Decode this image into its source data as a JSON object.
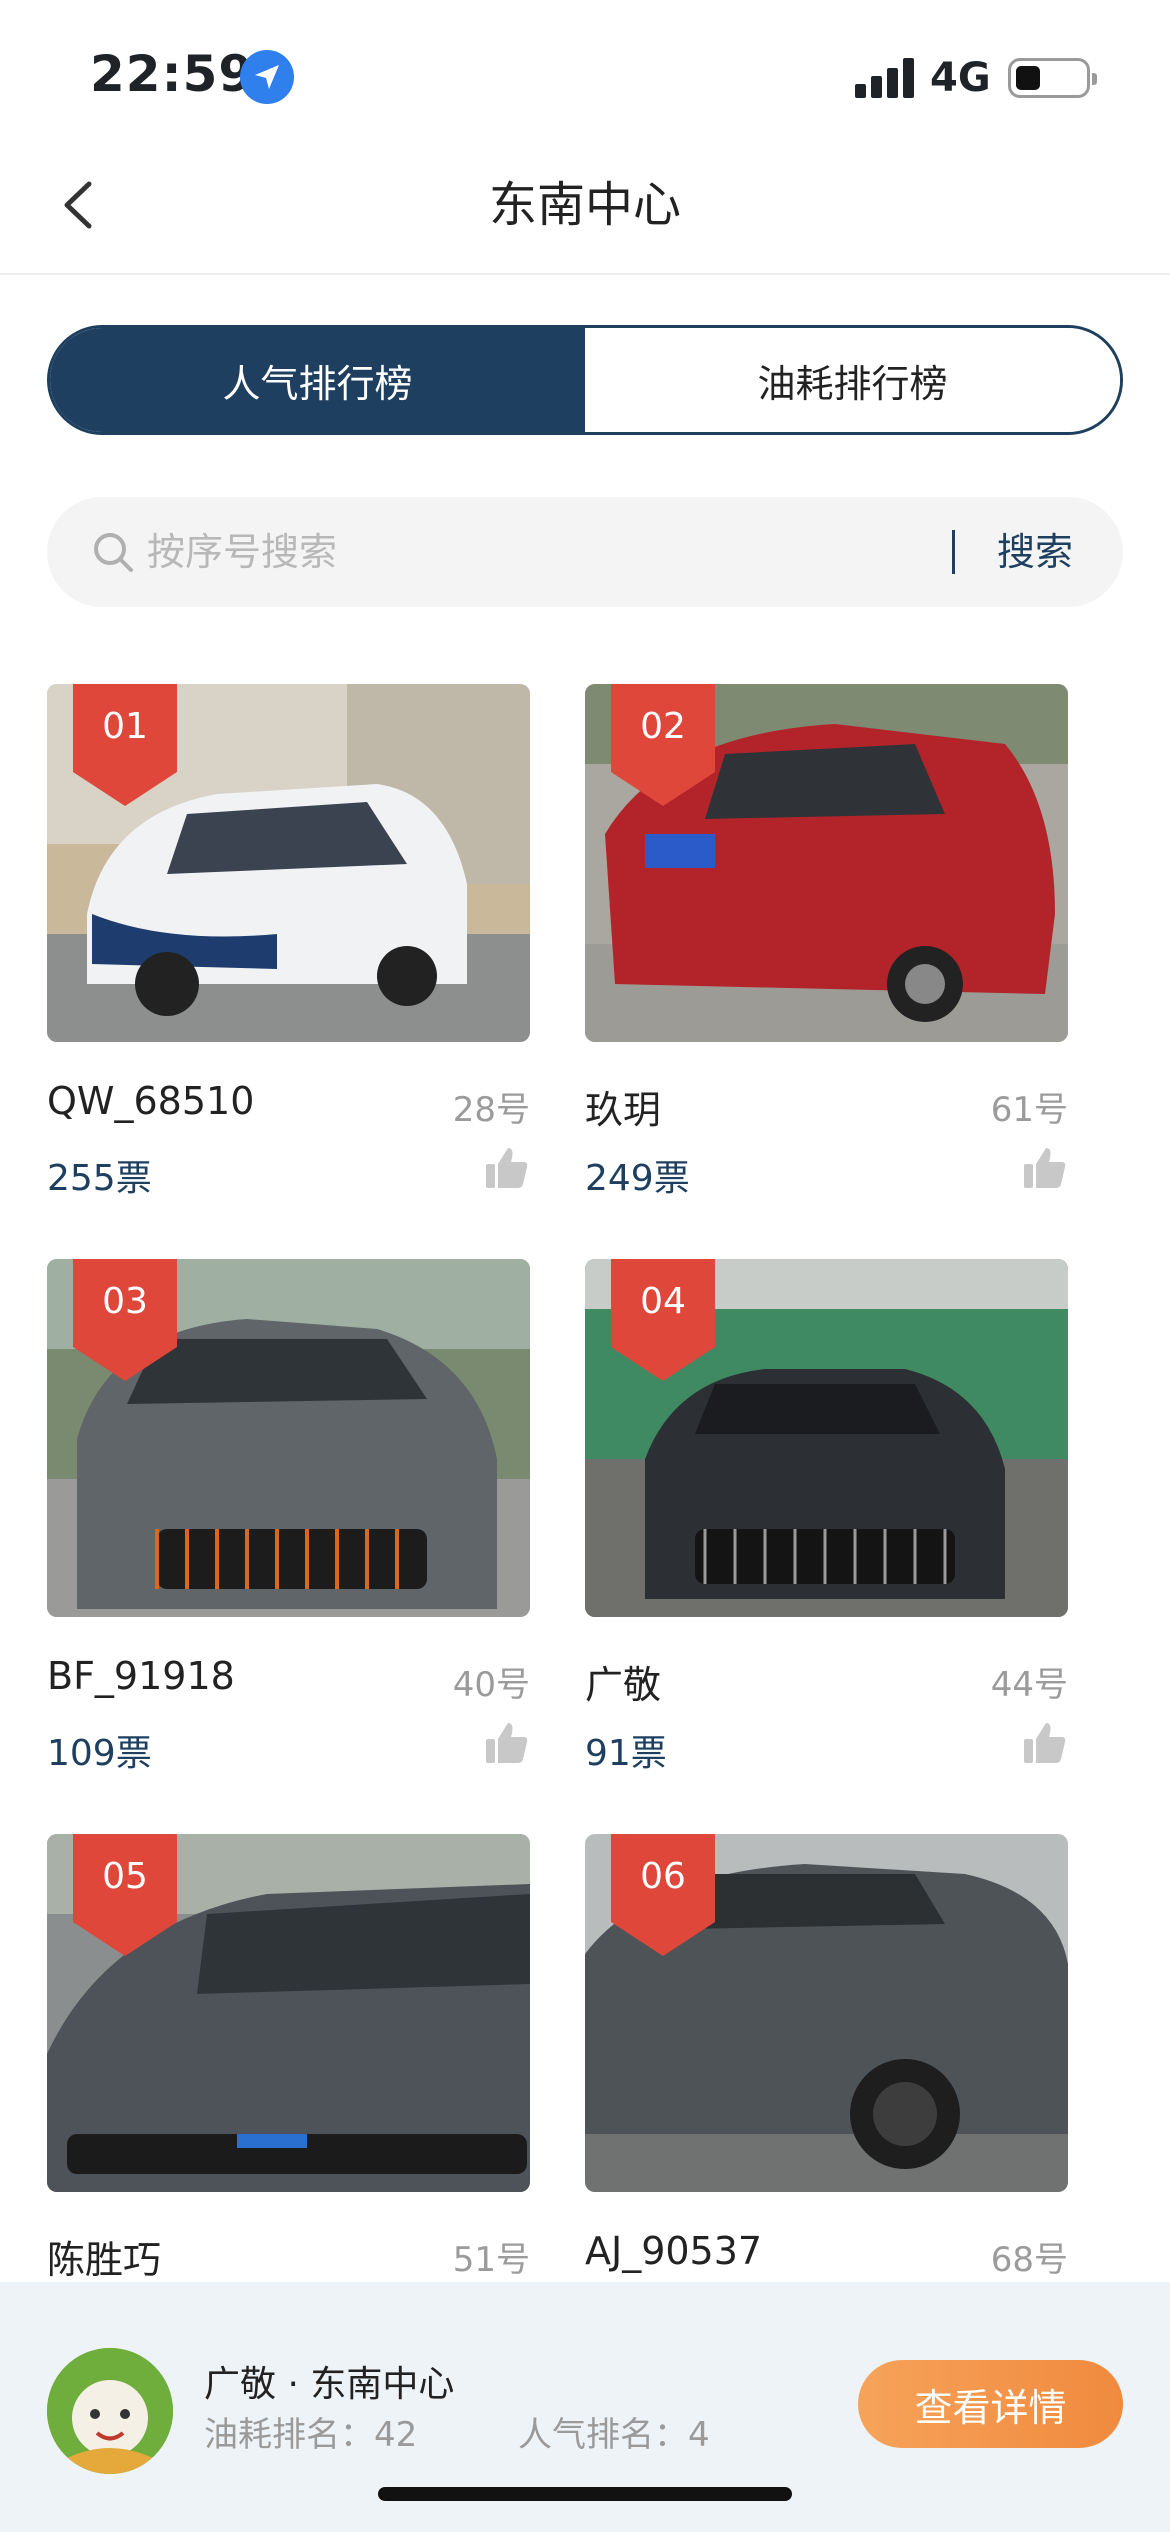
{
  "status_bar": {
    "time": "22:59",
    "network": "4G"
  },
  "nav": {
    "title": "东南中心"
  },
  "tabs": [
    {
      "label": "人气排行榜",
      "active": true
    },
    {
      "label": "油耗排行榜",
      "active": false
    }
  ],
  "search": {
    "placeholder": "按序号搜索",
    "button_label": "搜索"
  },
  "cards": [
    {
      "rank": "01",
      "name": "QW_68510",
      "number": "28号",
      "votes": "255票",
      "car_color": "white"
    },
    {
      "rank": "02",
      "name": "玖玥",
      "number": "61号",
      "votes": "249票",
      "car_color": "red"
    },
    {
      "rank": "03",
      "name": "BF_91918",
      "number": "40号",
      "votes": "109票",
      "car_color": "gray"
    },
    {
      "rank": "04",
      "name": "广敬",
      "number": "44号",
      "votes": "91票",
      "car_color": "dark-gray"
    },
    {
      "rank": "05",
      "name": "陈胜巧",
      "number": "51号",
      "votes": "",
      "car_color": "gray"
    },
    {
      "rank": "06",
      "name": "AJ_90537",
      "number": "68号",
      "votes": "",
      "car_color": "dark-gray"
    }
  ],
  "bottom_bar": {
    "title": "广敬 · 东南中心",
    "fuel_rank": "油耗排名：42",
    "popularity_rank": "人气排名：4",
    "detail_button": "查看详情"
  },
  "colors": {
    "primary": "#1e3f5f",
    "badge": "#e0473b",
    "cta_start": "#f6a35a",
    "cta_end": "#f08a3e"
  }
}
